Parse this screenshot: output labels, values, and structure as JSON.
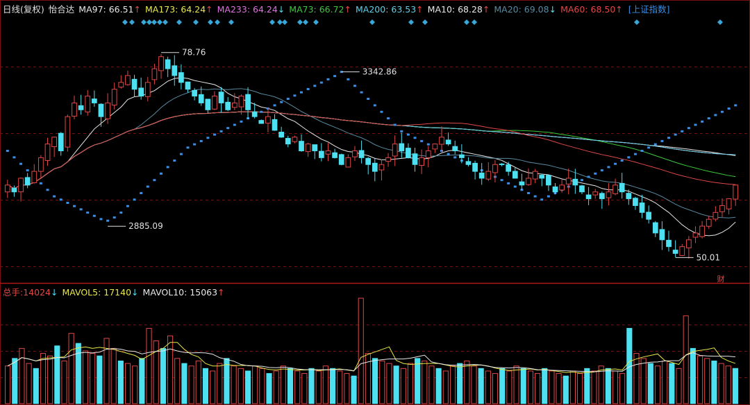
{
  "header": {
    "period": "日线(复权)",
    "stock": "怡合达",
    "ma": [
      {
        "name": "MA97",
        "value": "66.51",
        "arrow": "↑",
        "color": "#e8e8e8"
      },
      {
        "name": "MA173",
        "value": "64.24",
        "arrow": "↑",
        "color": "#e8e84a"
      },
      {
        "name": "MA233",
        "value": "64.24",
        "arrow": "↓",
        "color": "#e070e0"
      },
      {
        "name": "MA73",
        "value": "66.72",
        "arrow": "↑",
        "color": "#3cc83c"
      },
      {
        "name": "MA200",
        "value": "63.53",
        "arrow": "↑",
        "color": "#5fd0e8"
      },
      {
        "name": "MA10",
        "value": "68.28",
        "arrow": "↑",
        "color": "#e8e8e8"
      },
      {
        "name": "MA20",
        "value": "69.08",
        "arrow": "↓",
        "color": "#5a8aa0"
      },
      {
        "name": "MA60",
        "value": "68.50",
        "arrow": "↑",
        "color": "#e04848"
      }
    ],
    "index_link": "[上证指数]"
  },
  "volume_header": {
    "label": "总手:",
    "value": "14024",
    "arrow": "↓",
    "mavol5": {
      "name": "MAVOL5",
      "value": "17140",
      "arrow": "↓"
    },
    "mavol10": {
      "name": "MAVOL10",
      "value": "15063",
      "arrow": "↑"
    }
  },
  "annotations": {
    "stock_high": "78.76",
    "stock_low": "50.01",
    "index_high": "3342.86",
    "index_low": "2885.09",
    "event_marker": "财"
  },
  "colors": {
    "up": "#e04848",
    "down": "#4de0f0",
    "index": "#3a8ee6",
    "grid": "#7a1010",
    "background": "#000000"
  },
  "chart_data": [
    {
      "type": "candlestick",
      "title": "怡合达 日线(复权)",
      "ylim": [
        46,
        84
      ],
      "note": "approximate daily closes read from the chart, left to right",
      "closes": [
        60,
        59,
        61,
        60,
        62,
        64,
        66,
        67,
        65,
        70,
        72,
        71,
        73,
        72,
        70,
        72,
        74,
        75,
        76,
        74,
        73,
        75,
        77,
        78.76,
        77,
        76,
        75,
        74,
        73,
        72,
        71,
        73,
        72,
        71,
        72,
        73,
        71,
        70,
        69,
        70,
        68,
        67,
        66,
        67,
        65,
        66,
        65,
        64,
        65,
        64,
        63,
        64,
        65,
        64,
        63,
        62,
        63,
        64,
        66,
        65,
        64,
        63,
        64,
        65,
        66,
        67,
        66,
        65,
        64,
        63,
        62,
        61,
        62,
        63,
        63,
        62,
        61,
        60,
        61,
        62,
        61,
        60,
        59,
        60,
        61,
        60,
        59,
        58,
        59,
        58,
        59,
        60,
        59,
        58,
        57,
        56,
        55,
        53,
        52,
        51,
        50.01,
        51,
        52,
        53,
        54,
        55,
        56,
        57,
        58,
        60
      ],
      "moving_averages": [
        "MA97",
        "MA173",
        "MA233",
        "MA73",
        "MA200",
        "MA10",
        "MA20",
        "MA60"
      ]
    },
    {
      "type": "line",
      "series_name": "上证指数",
      "ylim": [
        2700,
        3500
      ],
      "values": [
        3100,
        3080,
        3060,
        3040,
        3020,
        3000,
        2980,
        2960,
        2950,
        2940,
        2930,
        2920,
        2910,
        2900,
        2890,
        2885.09,
        2895,
        2910,
        2930,
        2950,
        2970,
        2990,
        3010,
        3030,
        3050,
        3070,
        3090,
        3110,
        3120,
        3130,
        3140,
        3150,
        3160,
        3170,
        3180,
        3190,
        3200,
        3210,
        3220,
        3230,
        3240,
        3250,
        3260,
        3270,
        3280,
        3290,
        3300,
        3310,
        3320,
        3330,
        3342.86,
        3320,
        3300,
        3280,
        3260,
        3240,
        3220,
        3200,
        3180,
        3160,
        3150,
        3140,
        3130,
        3120,
        3110,
        3100,
        3090,
        3080,
        3070,
        3060,
        3050,
        3040,
        3030,
        3020,
        3010,
        3000,
        2990,
        2980,
        2970,
        2960,
        2950,
        2960,
        2970,
        2980,
        2990,
        3000,
        3010,
        3020,
        3030,
        3040,
        3050,
        3060,
        3070,
        3080,
        3090,
        3100,
        3110,
        3120,
        3130,
        3140,
        3150,
        3160,
        3170,
        3180,
        3190,
        3200,
        3210,
        3220,
        3230,
        3240
      ]
    },
    {
      "type": "bar",
      "title": "总手",
      "ylim": [
        0,
        42000
      ],
      "values": [
        15000,
        18000,
        22000,
        16000,
        14000,
        20000,
        19000,
        23000,
        17000,
        28000,
        24000,
        21000,
        20000,
        19000,
        26000,
        22000,
        17000,
        16000,
        15000,
        18000,
        30000,
        25000,
        22000,
        27000,
        18000,
        16000,
        15000,
        17000,
        14000,
        13000,
        16000,
        18000,
        15000,
        14000,
        13000,
        15000,
        14000,
        12000,
        13000,
        15000,
        14000,
        13000,
        12000,
        14000,
        13000,
        15000,
        14000,
        13000,
        12000,
        11000,
        42000,
        20000,
        18000,
        17000,
        16000,
        15000,
        14000,
        16000,
        18000,
        17000,
        15000,
        14000,
        13000,
        15000,
        16000,
        17000,
        15000,
        14000,
        13000,
        12000,
        14000,
        13000,
        15000,
        14000,
        13000,
        12000,
        14000,
        13000,
        12000,
        11000,
        13000,
        12000,
        14000,
        13000,
        15000,
        14000,
        13000,
        12000,
        30000,
        20000,
        18000,
        16000,
        15000,
        17000,
        16000,
        14000,
        35000,
        22000,
        19000,
        18000,
        17000,
        16000,
        15000,
        14024
      ],
      "series": [
        {
          "name": "MAVOL5",
          "value": 17140
        },
        {
          "name": "MAVOL10",
          "value": 15063
        }
      ]
    }
  ]
}
